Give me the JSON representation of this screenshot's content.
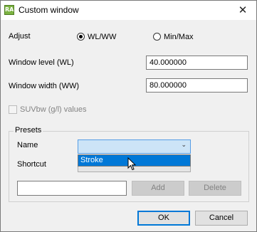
{
  "window": {
    "app_icon": "RA",
    "title": "Custom window",
    "close_glyph": "✕"
  },
  "adjust": {
    "label": "Adjust",
    "options": [
      "WL/WW",
      "Min/Max"
    ],
    "selected": "WL/WW"
  },
  "window_level": {
    "label": "Window level (WL)",
    "value": "40.000000"
  },
  "window_width": {
    "label": "Window width (WW)",
    "value": "80.000000"
  },
  "suvbw": {
    "label": "SUVbw (g/l) values",
    "checked": false,
    "enabled": false
  },
  "presets": {
    "label": "Presets",
    "name_label": "Name",
    "name_value": "",
    "dropdown_items": [
      "Stroke"
    ],
    "shortcut_label": "Shortcut",
    "shortcut_value": "",
    "new_preset_value": "",
    "add_label": "Add",
    "delete_label": "Delete"
  },
  "footer": {
    "ok_label": "OK",
    "cancel_label": "Cancel"
  },
  "icons": {
    "app": "app-logo-icon",
    "close": "close-icon",
    "chevron": "chevron-down-icon",
    "pointer": "mouse-pointer-icon"
  },
  "colors": {
    "selection": "#0078d7",
    "open_combo": "#cce4f7",
    "dialog_bg": "#f0f0f0"
  }
}
